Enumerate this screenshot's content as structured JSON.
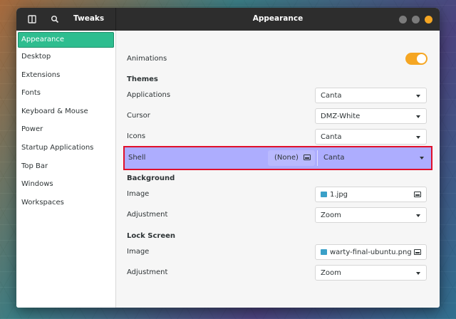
{
  "headerbar": {
    "app_title": "Tweaks",
    "page_title": "Appearance",
    "window_button_colors": [
      "#7b7b7b",
      "#7b7b7b",
      "#f5a623"
    ]
  },
  "sidebar": {
    "items": [
      {
        "label": "Appearance",
        "active": true
      },
      {
        "label": "Desktop"
      },
      {
        "label": "Extensions"
      },
      {
        "label": "Fonts"
      },
      {
        "label": "Keyboard & Mouse"
      },
      {
        "label": "Power"
      },
      {
        "label": "Startup Applications"
      },
      {
        "label": "Top Bar"
      },
      {
        "label": "Windows"
      },
      {
        "label": "Workspaces"
      }
    ]
  },
  "main": {
    "animations_label": "Animations",
    "animations_on": true,
    "themes": {
      "heading": "Themes",
      "applications_label": "Applications",
      "applications_value": "Canta",
      "cursor_label": "Cursor",
      "cursor_value": "DMZ-White",
      "icons_label": "Icons",
      "icons_value": "Canta",
      "shell_label": "Shell",
      "shell_file": "(None)",
      "shell_value": "Canta"
    },
    "background": {
      "heading": "Background",
      "image_label": "Image",
      "image_value": "1.jpg",
      "adjustment_label": "Adjustment",
      "adjustment_value": "Zoom"
    },
    "lock_screen": {
      "heading": "Lock Screen",
      "image_label": "Image",
      "image_value": "warty-final-ubuntu.png",
      "adjustment_label": "Adjustment",
      "adjustment_value": "Zoom"
    }
  },
  "colors": {
    "accent": "#2ebd8f",
    "toggle": "#f5a623",
    "highlight_fill": "#a0a0ff",
    "highlight_border": "#e0102a"
  }
}
